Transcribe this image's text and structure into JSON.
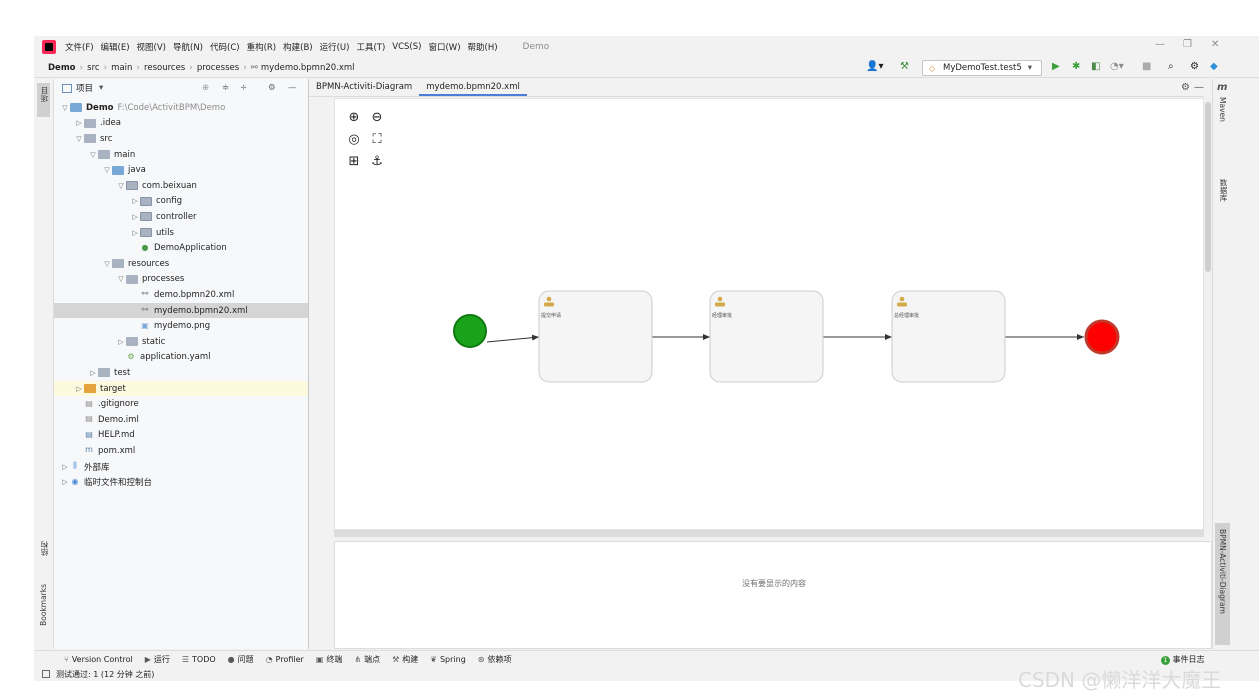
{
  "menubar": {
    "items": [
      "文件(F)",
      "编辑(E)",
      "视图(V)",
      "导航(N)",
      "代码(C)",
      "重构(R)",
      "构建(B)",
      "运行(U)",
      "工具(T)",
      "VCS(S)",
      "窗口(W)",
      "帮助(H)"
    ],
    "app_title": "Demo"
  },
  "breadcrumb": [
    "Demo",
    "src",
    "main",
    "resources",
    "processes",
    "mydemo.bpmn20.xml"
  ],
  "run_config": {
    "label": "MyDemoTest.test5"
  },
  "project_panel": {
    "title": "项目",
    "tree": [
      {
        "label": "Demo",
        "extra": "F:\\Code\\ActivitBPM\\Demo",
        "depth": 0,
        "arrow": "open",
        "icon": "folder-blue"
      },
      {
        "label": ".idea",
        "depth": 1,
        "arrow": "closed",
        "icon": "folder"
      },
      {
        "label": "src",
        "depth": 1,
        "arrow": "open",
        "icon": "folder"
      },
      {
        "label": "main",
        "depth": 2,
        "arrow": "open",
        "icon": "folder"
      },
      {
        "label": "java",
        "depth": 3,
        "arrow": "open",
        "icon": "folder-blue"
      },
      {
        "label": "com.beixuan",
        "depth": 4,
        "arrow": "open",
        "icon": "folder-pkg"
      },
      {
        "label": "config",
        "depth": 5,
        "arrow": "closed",
        "icon": "folder-pkg"
      },
      {
        "label": "controller",
        "depth": 5,
        "arrow": "closed",
        "icon": "folder-pkg"
      },
      {
        "label": "utils",
        "depth": 5,
        "arrow": "closed",
        "icon": "folder-pkg"
      },
      {
        "label": "DemoApplication",
        "depth": 5,
        "arrow": "none",
        "icon": "spring-class"
      },
      {
        "label": "resources",
        "depth": 3,
        "arrow": "open",
        "icon": "folder"
      },
      {
        "label": "processes",
        "depth": 4,
        "arrow": "open",
        "icon": "folder"
      },
      {
        "label": "demo.bpmn20.xml",
        "depth": 5,
        "arrow": "none",
        "icon": "bpmn"
      },
      {
        "label": "mydemo.bpmn20.xml",
        "depth": 5,
        "arrow": "none",
        "icon": "bpmn",
        "selected": true
      },
      {
        "label": "mydemo.png",
        "depth": 5,
        "arrow": "none",
        "icon": "image"
      },
      {
        "label": "static",
        "depth": 4,
        "arrow": "closed",
        "icon": "folder"
      },
      {
        "label": "application.yaml",
        "depth": 4,
        "arrow": "none",
        "icon": "yaml"
      },
      {
        "label": "test",
        "depth": 2,
        "arrow": "closed",
        "icon": "folder"
      },
      {
        "label": "target",
        "depth": 1,
        "arrow": "closed",
        "icon": "folder-orange",
        "highlight": true
      },
      {
        "label": ".gitignore",
        "depth": 1,
        "arrow": "none",
        "icon": "file"
      },
      {
        "label": "Demo.iml",
        "depth": 1,
        "arrow": "none",
        "icon": "file"
      },
      {
        "label": "HELP.md",
        "depth": 1,
        "arrow": "none",
        "icon": "md"
      },
      {
        "label": "pom.xml",
        "depth": 1,
        "arrow": "none",
        "icon": "maven"
      },
      {
        "label": "外部库",
        "depth": 0,
        "arrow": "closed",
        "icon": "lib"
      },
      {
        "label": "临时文件和控制台",
        "depth": 0,
        "arrow": "closed",
        "icon": "scratch"
      }
    ]
  },
  "left_strip": {
    "project_label": "项目",
    "structure_label": "结构",
    "bookmarks_label": "Bookmarks"
  },
  "editor": {
    "tabs": [
      {
        "label": "BPMN-Activiti-Diagram",
        "active": false
      },
      {
        "label": "mydemo.bpmn20.xml",
        "active": true
      }
    ]
  },
  "diagram": {
    "tasks": [
      {
        "label": "提交申请"
      },
      {
        "label": "经理审批"
      },
      {
        "label": "总经理审批"
      }
    ],
    "colors": {
      "start": "#1aa31a",
      "end": "#ff0000",
      "end_stroke": "#c0392b",
      "task_fill": "#f5f5f5",
      "task_stroke": "#cccccc"
    }
  },
  "properties_panel": {
    "empty_message": "没有要显示的内容"
  },
  "right_strip": {
    "maven": "Maven",
    "database": "数据库",
    "bpmn": "BPMN-Activiti-Diagram"
  },
  "bottom_tools": [
    {
      "label": "Version Control",
      "icon": "vcs-icon"
    },
    {
      "label": "运行",
      "icon": "run-icon"
    },
    {
      "label": "TODO",
      "icon": "todo-icon"
    },
    {
      "label": "问题",
      "icon": "problems-icon"
    },
    {
      "label": "Profiler",
      "icon": "profiler-icon"
    },
    {
      "label": "终端",
      "icon": "terminal-icon"
    },
    {
      "label": "端点",
      "icon": "endpoints-icon"
    },
    {
      "label": "构建",
      "icon": "build-icon"
    },
    {
      "label": "Spring",
      "icon": "spring-icon"
    },
    {
      "label": "依赖项",
      "icon": "dependencies-icon"
    }
  ],
  "event_log": {
    "label": "事件日志",
    "count": "1"
  },
  "status": {
    "text": "测试通过: 1 (12 分钟 之前)"
  },
  "watermark": "CSDN @懒洋洋大魔王"
}
